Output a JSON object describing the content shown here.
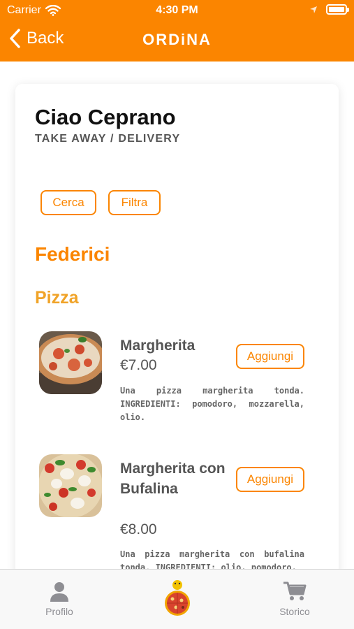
{
  "status_bar": {
    "carrier": "Carrier",
    "time": "4:30 PM",
    "wifi_icon": "wifi-icon",
    "location_icon": "location-arrow-icon",
    "battery_icon": "battery-icon"
  },
  "nav": {
    "back_label": "Back",
    "title": "ORDiNA",
    "back_icon": "chevron-left-icon"
  },
  "restaurant": {
    "name": "Ciao Ceprano",
    "subtitle": "TAKE AWAY / DELIVERY"
  },
  "actions": {
    "search_label": "Cerca",
    "filter_label": "Filtra"
  },
  "section": {
    "name": "Federici"
  },
  "category": {
    "name": "Pizza"
  },
  "menu_items": [
    {
      "name": "Margherita",
      "price": "€7.00",
      "add_label": "Aggiungi",
      "description": "Una pizza margherita tonda. INGREDIENTI: pomodoro, mozzarella, olio."
    },
    {
      "name": "Margherita con Bufalina",
      "price": "€8.00",
      "add_label": "Aggiungi",
      "description": "Una pizza margherita con bufalina tonda. INGREDIENTI: olio, pomodoro,"
    }
  ],
  "tabbar": {
    "profile_label": "Profilo",
    "history_label": "Storico",
    "profile_icon": "person-icon",
    "center_icon": "pizza-logo-icon",
    "history_icon": "cart-icon"
  },
  "colors": {
    "brand": "#fb8500",
    "category": "#f0a328",
    "tab_inactive": "#8e8e93"
  }
}
